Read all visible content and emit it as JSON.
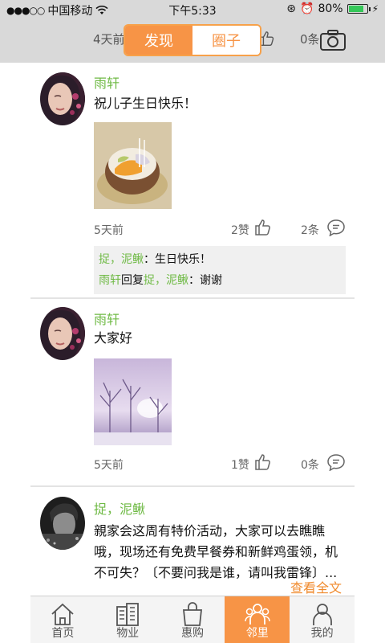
{
  "status_bar": {
    "carrier": "中国移动",
    "time": "下午5:33",
    "battery_text": "80%",
    "battery_level": 0.8
  },
  "header": {
    "left_hint": "4天前",
    "right_hint": "0条",
    "tabs": [
      "发现",
      "圈子"
    ],
    "active_tab": "发现",
    "accent_color": "#f79446"
  },
  "posts": [
    {
      "author": "雨轩",
      "content": "祝儿子生日快乐！",
      "time": "5天前",
      "likes": "2赞",
      "comments": "2条",
      "comment_lines": [
        {
          "from": "捉，泥鳅",
          "sep": "：",
          "text": "生日快乐！"
        },
        {
          "from": "雨轩",
          "mid": "回复",
          "to": "捉，泥鳅",
          "sep": "：",
          "text": "谢谢"
        }
      ]
    },
    {
      "author": "雨轩",
      "content": "大家好",
      "time": "5天前",
      "likes": "1赞",
      "comments": "0条"
    },
    {
      "author": "捉，泥鳅",
      "content": "親家会这周有特价活动，大家可以去瞧瞧哦，现场还有免费早餐券和新鲜鸡蛋领，机不可失？〔不要问我是谁，请叫我雷锋〕...",
      "more": "查看全文"
    }
  ],
  "tabbar": {
    "items": [
      {
        "label": "首页",
        "icon": "home-icon"
      },
      {
        "label": "物业",
        "icon": "building-icon"
      },
      {
        "label": "惠购",
        "icon": "shopping-bag-icon"
      },
      {
        "label": "邻里",
        "icon": "neighbors-icon"
      },
      {
        "label": "我的",
        "icon": "person-icon"
      }
    ],
    "active": "邻里"
  }
}
